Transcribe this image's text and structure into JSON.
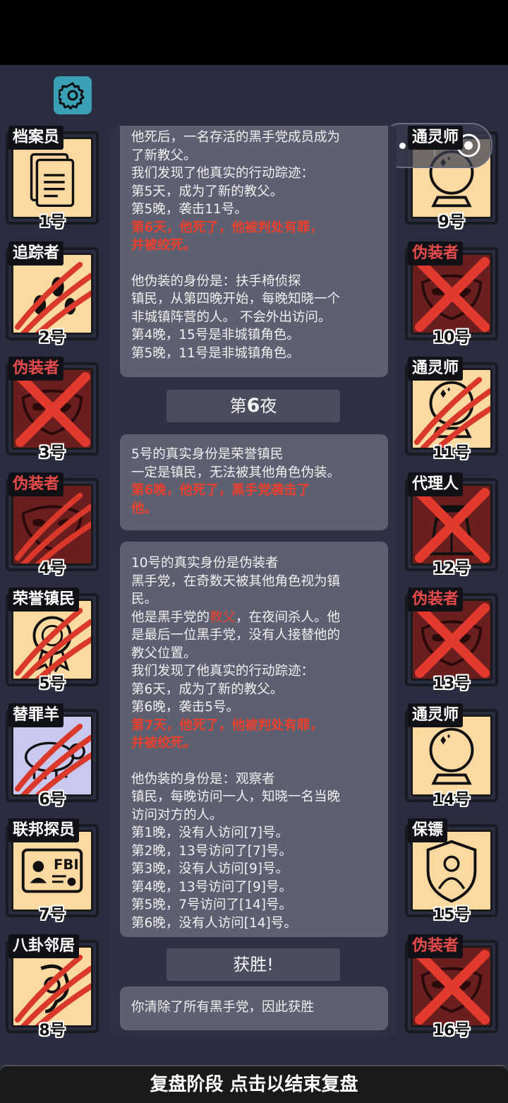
{
  "colors": {
    "accent_red": "#e8402f",
    "settings_bg": "#3aa0b4",
    "card_bg": "#fbd9a0",
    "dead_card_bg": "#6b1e1e"
  },
  "top_icons": {
    "settings": "gear-icon",
    "menu": "more-dots-icon",
    "close": "target-circle-icon"
  },
  "players_left": [
    {
      "role": "档案员",
      "num": "1号",
      "status": "alive",
      "icon": "documents-icon",
      "role_color": "white"
    },
    {
      "role": "追踪者",
      "num": "2号",
      "status": "scratched",
      "icon": "footprints-icon",
      "role_color": "white"
    },
    {
      "role": "伪装者",
      "num": "3号",
      "status": "crossed",
      "icon": "mask-icon",
      "role_color": "red"
    },
    {
      "role": "伪装者",
      "num": "4号",
      "status": "scratched",
      "icon": "mask-icon",
      "role_color": "red"
    },
    {
      "role": "荣誉镇民",
      "num": "5号",
      "status": "scratched",
      "icon": "medal-icon",
      "role_color": "white"
    },
    {
      "role": "替罪羊",
      "num": "6号",
      "status": "scratched",
      "icon": "sheep-icon",
      "role_color": "white"
    },
    {
      "role": "联邦探员",
      "num": "7号",
      "status": "alive",
      "icon": "fbi-badge-icon",
      "role_color": "white"
    },
    {
      "role": "八卦邻居",
      "num": "8号",
      "status": "scratched",
      "icon": "ear-icon",
      "role_color": "white"
    }
  ],
  "players_right": [
    {
      "role": "通灵师",
      "num": "9号",
      "status": "alive",
      "icon": "crystal-ball-icon",
      "role_color": "white"
    },
    {
      "role": "伪装者",
      "num": "10号",
      "status": "crossed",
      "icon": "mask-icon",
      "role_color": "red"
    },
    {
      "role": "通灵师",
      "num": "11号",
      "status": "scratched",
      "icon": "crystal-ball-icon",
      "role_color": "white"
    },
    {
      "role": "代理人",
      "num": "12号",
      "status": "crossed",
      "icon": "agent-coat-icon",
      "role_color": "white"
    },
    {
      "role": "伪装者",
      "num": "13号",
      "status": "crossed",
      "icon": "mask-icon",
      "role_color": "red"
    },
    {
      "role": "通灵师",
      "num": "14号",
      "status": "alive",
      "icon": "crystal-ball-icon",
      "role_color": "white"
    },
    {
      "role": "保镖",
      "num": "15号",
      "status": "alive",
      "icon": "shield-person-icon",
      "role_color": "white"
    },
    {
      "role": "伪装者",
      "num": "16号",
      "status": "crossed",
      "icon": "mask-icon",
      "role_color": "red"
    }
  ],
  "log": {
    "bubble1": {
      "l1": "他死后，一名存活的黑手党成员成为",
      "l2": "了新教父。",
      "l3": "我们发现了他真实的行动踪迹：",
      "l4": "第5天，成为了新的教父。",
      "l5": "第5晚，袭击11号。",
      "l6": "第6天，他死了，他被判处有罪，",
      "l7": "并被绞死。",
      "l8": "他伪装的身份是：扶手椅侦探",
      "l9": "镇民，从第四晚开始，每晚知晓一个",
      "l10": "非城镇阵营的人。 不会外出访问。",
      "l11": "第4晚，15号是非城镇角色。",
      "l12": "第5晚，11号是非城镇角色。"
    },
    "night_header_prefix": "第",
    "night_header_num": "6",
    "night_header_suffix": "夜",
    "bubble2": {
      "l1": "5号的真实身份是荣誉镇民",
      "l2": "一定是镇民，无法被其他角色伪装。",
      "l3": "第6晚，他死了，黑手党袭击了",
      "l4": "他。"
    },
    "bubble3": {
      "l1": "10号的真实身份是伪装者",
      "l2": "黑手党，在奇数天被其他角色视为镇",
      "l3": "民。",
      "l4a": "他是黑手党的",
      "l4b": "教父",
      "l4c": "，在夜间杀人。他",
      "l5": "是最后一位黑手党，没有人接替他的",
      "l6": "教父位置。",
      "l7": "我们发现了他真实的行动踪迹：",
      "l8": "第6天，成为了新的教父。",
      "l9": "第6晚，袭击5号。",
      "l10": "第7天，他死了，他被判处有罪，",
      "l11": "并被绞死。",
      "l12": "他伪装的身份是：观察者",
      "l13": "镇民，每晚访问一人，知晓一名当晚",
      "l14": "访问对方的人。",
      "l15": "第1晚，没有人访问[7]号。",
      "l16": "第2晚，13号访问了[7]号。",
      "l17": "第3晚，没有人访问[9]号。",
      "l18": "第4晚，13号访问了[9]号。",
      "l19": "第5晚，7号访问了[14]号。",
      "l20": "第6晚，没有人访问[14]号。"
    },
    "victory_header": "获胜!",
    "bubble4": {
      "l1": "你清除了所有黑手党，因此获胜"
    }
  },
  "bottom_bar": {
    "label": "复盘阶段 点击以结束复盘"
  }
}
